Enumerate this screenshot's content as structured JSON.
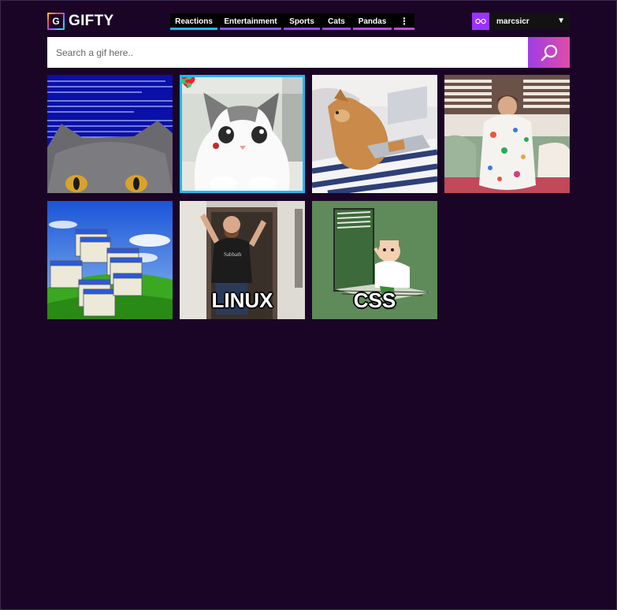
{
  "brand": {
    "logo_letter": "G",
    "name": "GIFTY"
  },
  "nav": {
    "items": [
      {
        "label": "Reactions",
        "color": "#22b8f0"
      },
      {
        "label": "Entertainment",
        "color": "#7a5cff"
      },
      {
        "label": "Sports",
        "color": "#8a4cff"
      },
      {
        "label": "Cats",
        "color": "#9b4cf0"
      },
      {
        "label": "Pandas",
        "color": "#b24ce0"
      }
    ],
    "more_glyph": "⋮",
    "more_color": "#c04cd6"
  },
  "user": {
    "name": "marcsicr",
    "caret": "▼",
    "avatar_icon": "glasses-icon"
  },
  "search": {
    "placeholder": "Search a gif here..",
    "value": "",
    "button_icon": "search-icon"
  },
  "gifs": [
    {
      "name": "cat-bsod",
      "caption": ""
    },
    {
      "name": "cat-sitting",
      "caption": "",
      "selected": true,
      "actions": [
        "heart-icon",
        "share-icon"
      ]
    },
    {
      "name": "dog-laptop",
      "caption": ""
    },
    {
      "name": "blanket-woman",
      "caption": ""
    },
    {
      "name": "xp-error-windows",
      "caption": ""
    },
    {
      "name": "linux-man",
      "caption": "LINUX"
    },
    {
      "name": "css-blinds",
      "caption": "CSS"
    }
  ],
  "colors": {
    "background": "#1b0526",
    "accent_selected": "#22b8f0",
    "heart": "#ff1a2e",
    "share": "#2fd06a"
  }
}
